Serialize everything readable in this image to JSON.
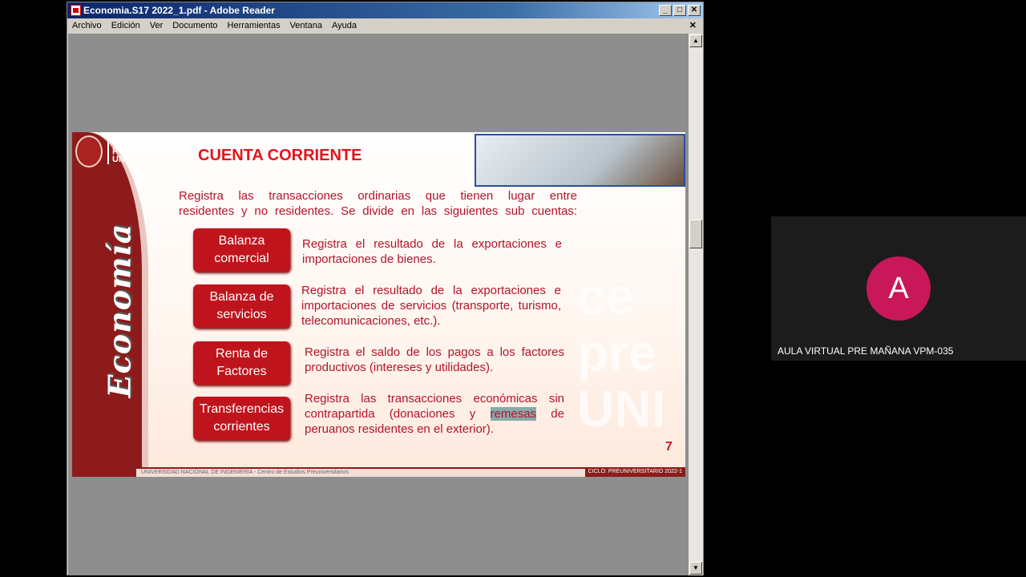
{
  "window": {
    "title": "Economia.S17 2022_1.pdf - Adobe Reader",
    "minimize": "_",
    "maximize": "□",
    "close": "✕"
  },
  "menu": [
    "Archivo",
    "Edición",
    "Ver",
    "Documento",
    "Herramientas",
    "Ventana",
    "Ayuda"
  ],
  "menu_close": "✕",
  "slide": {
    "logo_text": "ce pre UNI",
    "side_title": "Economía",
    "title": "CUENTA CORRIENTE",
    "intro": [
      "Registra las transacciones ordinarias que tienen lugar entre",
      "residentes y no residentes. Se divide en las siguientes sub cuentas:"
    ],
    "rows": [
      {
        "button": "Balanza comercial",
        "text": "Registra el resultado de la exportaciones e importaciones de bienes."
      },
      {
        "button": "Balanza de servicios",
        "text": "Registra el resultado de la exportaciones e importaciones de servicios (transporte, turismo, telecomunicaciones, etc.)."
      },
      {
        "button": "Renta de Factores",
        "text": "Registra el saldo de los pagos a los factores productivos (intereses y utilidades)."
      },
      {
        "button": "Transferencias corrientes",
        "text_before": "Registra las transacciones económicas sin contrapartida (donaciones y ",
        "text_highlight": "remesas",
        "text_after": " de peruanos residentes en el exterior)."
      }
    ],
    "watermark": "ce pre UNI",
    "page_number": "7",
    "footer_left": "UNIVERSIDAD NACIONAL DE INGENIERÍA - Centro de Estudios Preuniversitarios",
    "footer_right": "CICLO: PREUNIVERSITARIO 2022-1"
  },
  "participant": {
    "initial": "A",
    "name": "AULA VIRTUAL PRE MAÑANA VPM-035",
    "color": "#c8185a"
  }
}
